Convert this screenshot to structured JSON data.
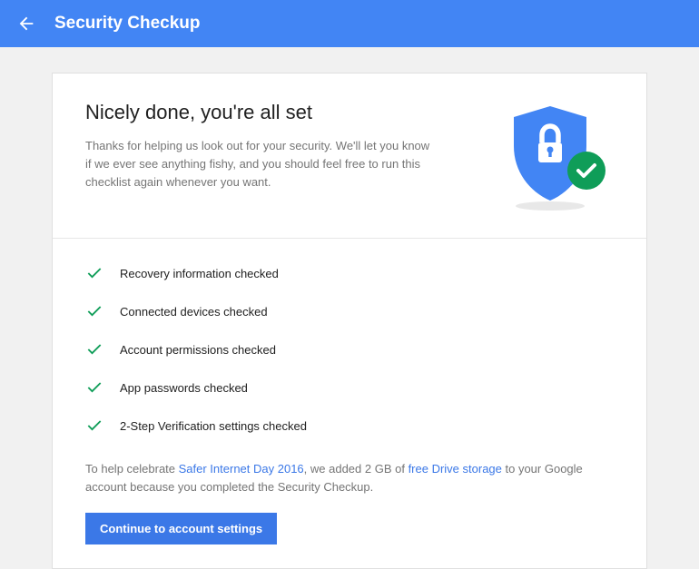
{
  "header": {
    "title": "Security Checkup"
  },
  "main": {
    "title": "Nicely done, you're all set",
    "description": "Thanks for helping us look out for your security. We'll let you know if we ever see anything fishy, and you should feel free to run this checklist again whenever you want."
  },
  "checklist": [
    {
      "label": "Recovery information checked"
    },
    {
      "label": "Connected devices checked"
    },
    {
      "label": "Account permissions checked"
    },
    {
      "label": "App passwords checked"
    },
    {
      "label": "2-Step Verification settings checked"
    }
  ],
  "promo": {
    "prefix": "To help celebrate ",
    "link1": "Safer Internet Day 2016",
    "mid": ", we added 2 GB of ",
    "link2": "free Drive storage",
    "suffix": " to your Google account because you completed the Security Checkup."
  },
  "button": {
    "continue": "Continue to account settings"
  },
  "colors": {
    "primary": "#4285f4",
    "success": "#0f9d58"
  }
}
